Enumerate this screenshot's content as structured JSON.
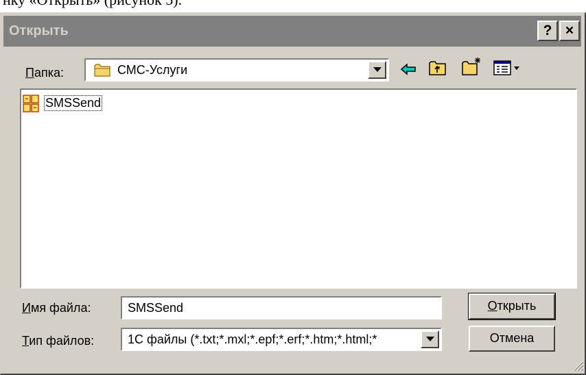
{
  "caption": "нку «Открыть» (рисунок 5).",
  "dialog": {
    "title": "Открыть",
    "help_label": "?",
    "close_label": "×"
  },
  "folder": {
    "label_underlined": "П",
    "label_rest": "апка:",
    "value": "СМС-Услуги"
  },
  "toolbar": {
    "icons": [
      "back-icon",
      "up-folder-icon",
      "new-folder-icon",
      "view-menu-icon"
    ]
  },
  "files": [
    {
      "name": "SMSSend",
      "icon": "1c-file-icon"
    }
  ],
  "filename": {
    "label_underlined": "И",
    "label_rest": "мя файла:",
    "value": "SMSSend"
  },
  "filetype": {
    "label_underlined": "Т",
    "label_rest": "ип файлов:",
    "value": "1С файлы (*.txt;*.mxl;*.epf;*.erf;*.htm;*.html;*"
  },
  "buttons": {
    "open_underlined": "О",
    "open_rest": "ткрыть",
    "cancel": "Отмена"
  }
}
